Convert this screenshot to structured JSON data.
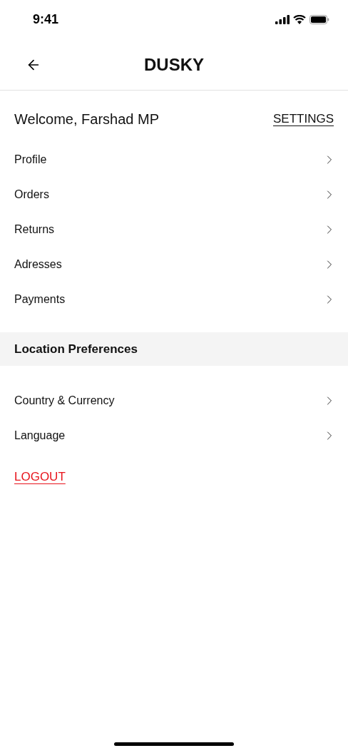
{
  "status_bar": {
    "time": "9:41"
  },
  "header": {
    "title": "DUSKY"
  },
  "welcome": {
    "text": "Welcome, Farshad MP",
    "settings_link": "SETTINGS"
  },
  "account_items": [
    {
      "label": "Profile"
    },
    {
      "label": "Orders"
    },
    {
      "label": "Returns"
    },
    {
      "label": "Adresses"
    },
    {
      "label": "Payments"
    }
  ],
  "location_section": {
    "title": "Location Preferences",
    "items": [
      {
        "label": "Country & Currency"
      },
      {
        "label": "Language"
      }
    ]
  },
  "logout": "LOGOUT"
}
